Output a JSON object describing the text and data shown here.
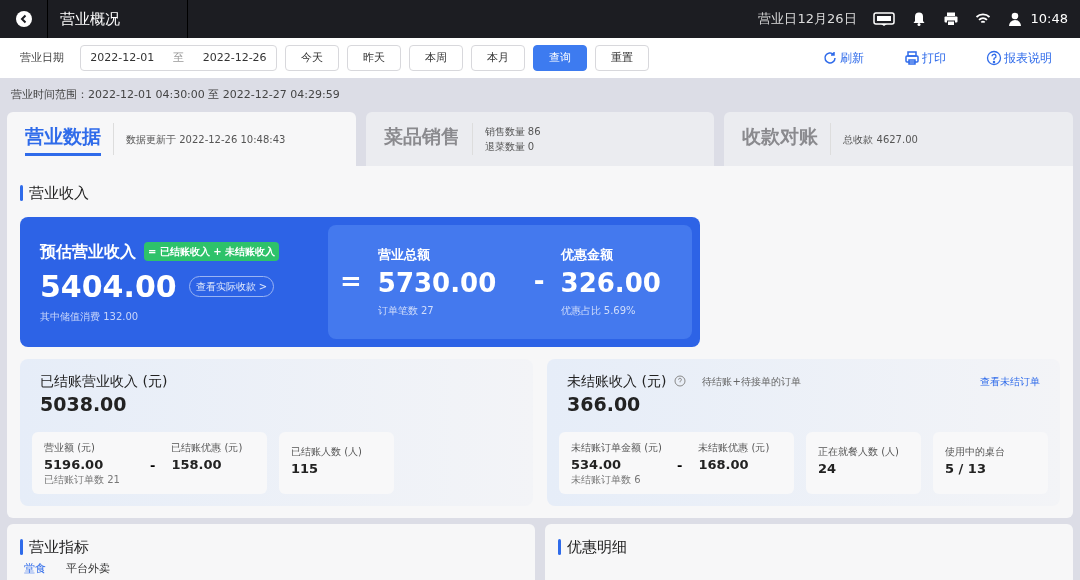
{
  "header": {
    "title": "营业概况",
    "business_day": "营业日12月26日",
    "time": "10:48"
  },
  "toolbar": {
    "date_label": "营业日期",
    "start": "2022-12-01",
    "separator": "至",
    "end": "2022-12-26",
    "buttons": [
      {
        "label": "今天",
        "selected": false
      },
      {
        "label": "昨天",
        "selected": false
      },
      {
        "label": "本周",
        "selected": false
      },
      {
        "label": "本月",
        "selected": false
      },
      {
        "label": "查询",
        "selected": true
      },
      {
        "label": "重置",
        "selected": false
      }
    ],
    "actions": [
      {
        "label": "刷新",
        "kind": "refresh"
      },
      {
        "label": "打印",
        "kind": "print"
      },
      {
        "label": "报表说明",
        "kind": "help"
      }
    ]
  },
  "range_text": "营业时间范围：2022-12-01 04:30:00 至 2022-12-27 04:29:59",
  "tabs": [
    {
      "title": "营业数据",
      "selected": true,
      "lines": [
        "数据更新于 2022-12-26 10:48:43"
      ]
    },
    {
      "title": "菜品销售",
      "selected": false,
      "lines": [
        "销售数量 86",
        "退菜数量 0"
      ]
    },
    {
      "title": "收款对账",
      "selected": false,
      "lines": [
        "总收款 4627.00"
      ]
    }
  ],
  "income": {
    "title": "营业收入",
    "estimate": {
      "label": "预估营业收入",
      "formula": "= 已结账收入 + 未结账收入",
      "value": "5404.00",
      "link": "查看实际收款 >",
      "note": "其中储值消费 132.00"
    },
    "equals": "=",
    "total": {
      "label": "营业总额",
      "value": "5730.00",
      "note": "订单笔数 27"
    },
    "minus": "-",
    "discount": {
      "label": "优惠金额",
      "value": "326.00",
      "note": "优惠占比 5.69%"
    }
  },
  "summaries": [
    {
      "title": "已结账营业收入 (元)",
      "value": "5038.00",
      "breakdown": {
        "left": {
          "label": "营业额 (元)",
          "value": "5196.00",
          "note": "已结账订单数 21"
        },
        "minus": "-",
        "right": {
          "label": "已结账优惠 (元)",
          "value": "158.00"
        }
      },
      "cards": [
        {
          "label": "已结账人数 (人)",
          "value": "115"
        }
      ]
    },
    {
      "title": "未结账收入 (元)",
      "hint": "待结账+待接单的订单",
      "link": "查看未结订单",
      "value": "366.00",
      "breakdown": {
        "left": {
          "label": "未结账订单金额 (元)",
          "value": "534.00",
          "note": "未结账订单数 6"
        },
        "minus": "-",
        "right": {
          "label": "未结账优惠 (元)",
          "value": "168.00"
        }
      },
      "cards": [
        {
          "label": "正在就餐人数 (人)",
          "value": "24"
        },
        {
          "label": "使用中的桌台",
          "value": "5 / 13"
        }
      ]
    }
  ],
  "bottom_panels": [
    {
      "title": "营业指标",
      "tabs": [
        {
          "label": "堂食",
          "selected": true
        },
        {
          "label": "平台外卖",
          "selected": false
        }
      ]
    },
    {
      "title": "优惠明细"
    }
  ]
}
